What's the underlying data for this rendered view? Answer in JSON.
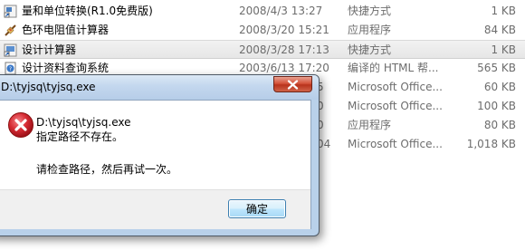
{
  "files": [
    {
      "name": "量和单位转换(R1.0免费版)",
      "date": "2008/4/3 13:27",
      "type": "快捷方式",
      "size": "1 KB",
      "icon": "shortcut-icon"
    },
    {
      "name": "色环电阻值计算器",
      "date": "2008/3/20 15:21",
      "type": "应用程序",
      "size": "84 KB",
      "icon": "resistor-app-icon"
    },
    {
      "name": "设计计算器",
      "date": "2008/3/28 17:13",
      "type": "快捷方式",
      "size": "1 KB",
      "icon": "shortcut-icon"
    },
    {
      "name": "设计资料查询系统",
      "date": "2003/6/13 17:20",
      "type": "编译的 HTML 帮...",
      "size": "565 KB",
      "icon": "help-file-icon"
    },
    {
      "name": "",
      "date": "5",
      "type": "Microsoft Office...",
      "size": "60 KB",
      "icon": ""
    },
    {
      "name": "",
      "date": "0",
      "type": "Microsoft Office...",
      "size": "100 KB",
      "icon": ""
    },
    {
      "name": "",
      "date": "0",
      "type": "应用程序",
      "size": "80 KB",
      "icon": ""
    },
    {
      "name": "",
      "date": "04",
      "type": "Microsoft Office...",
      "size": "1,018 KB",
      "icon": ""
    }
  ],
  "dialog": {
    "title": "D:\\tyjsq\\tyjsq.exe",
    "message_path": "D:\\tyjsq\\tyjsq.exe",
    "message_error": "指定路径不存在。",
    "message_hint": "请检查路径，然后再试一次。",
    "ok_label": "确定",
    "icon": "error-icon"
  },
  "colors": {
    "selection": "#e6e6e6",
    "close_button": "#c9432b",
    "error_red": "#c8202a",
    "dialog_frame": "#b9d1ea"
  }
}
